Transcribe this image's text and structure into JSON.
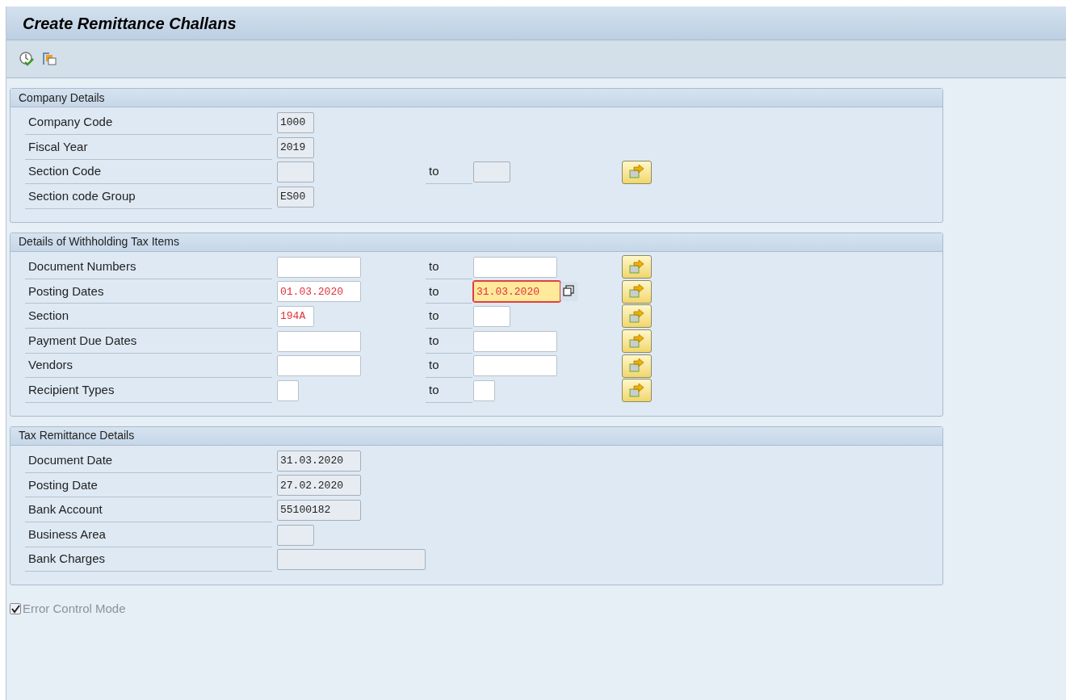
{
  "window": {
    "title": "Create Remittance Challans"
  },
  "toolbar": {
    "buttons": [
      {
        "kind": "execute"
      },
      {
        "kind": "variants"
      }
    ]
  },
  "groups": [
    {
      "title": "Company Details",
      "rows": [
        {
          "label": "Company Code",
          "field": {
            "value": "1000",
            "kind": "small",
            "editable": false
          }
        },
        {
          "label": "Fiscal Year",
          "field": {
            "value": "2019",
            "kind": "small",
            "editable": false
          }
        },
        {
          "label": "Section Code",
          "field": {
            "kind": "small",
            "editable": false
          },
          "to_label": "to",
          "to_field": {
            "kind": "small",
            "editable": false
          },
          "multiple_selection": true
        },
        {
          "label": "Section code Group",
          "field": {
            "value": "ES00",
            "kind": "small",
            "editable": false
          }
        }
      ]
    },
    {
      "title": "Details of Withholding Tax Items",
      "rows": [
        {
          "label": "Document Numbers",
          "field": {
            "kind": "medium",
            "editable": true
          },
          "to_label": "to",
          "to_field": {
            "kind": "medium",
            "editable": true
          },
          "multiple_selection": true
        },
        {
          "label": "Posting Dates",
          "field": {
            "value": "01.03.2020",
            "kind": "medium",
            "editable": true
          },
          "to_label": "to",
          "to_field": {
            "value": "31.03.2020",
            "kind": "medium",
            "editable": true,
            "focused": true
          },
          "multiple_selection": true
        },
        {
          "label": "Section",
          "field": {
            "value": "194A",
            "kind": "small",
            "editable": true
          },
          "to_label": "to",
          "to_field": {
            "kind": "small",
            "editable": true
          },
          "multiple_selection": true
        },
        {
          "label": "Payment Due Dates",
          "field": {
            "kind": "medium",
            "editable": true
          },
          "to_label": "to",
          "to_field": {
            "kind": "medium",
            "editable": true
          },
          "multiple_selection": true
        },
        {
          "label": "Vendors",
          "field": {
            "kind": "medium",
            "editable": true
          },
          "to_label": "to",
          "to_field": {
            "kind": "medium",
            "editable": true
          },
          "multiple_selection": true
        },
        {
          "label": "Recipient Types",
          "field": {
            "kind": "tiny",
            "editable": true
          },
          "to_label": "to",
          "to_field": {
            "kind": "tiny",
            "editable": true
          },
          "multiple_selection": true
        }
      ]
    },
    {
      "title": "Tax Remittance Details",
      "rows": [
        {
          "label": "Document Date",
          "field": {
            "value": "31.03.2020",
            "kind": "medium",
            "editable": false
          }
        },
        {
          "label": "Posting Date",
          "field": {
            "value": "27.02.2020",
            "kind": "medium",
            "editable": false
          }
        },
        {
          "label": "Bank Account",
          "field": {
            "value": "55100182",
            "kind": "medium",
            "editable": false
          }
        },
        {
          "label": "Business Area",
          "field": {
            "kind": "small",
            "editable": false
          }
        },
        {
          "label": "Bank Charges",
          "field": {
            "kind": "large",
            "editable": false
          }
        }
      ]
    }
  ],
  "error_control": {
    "label": "Error Control Mode",
    "checked": true,
    "disabled": true
  }
}
